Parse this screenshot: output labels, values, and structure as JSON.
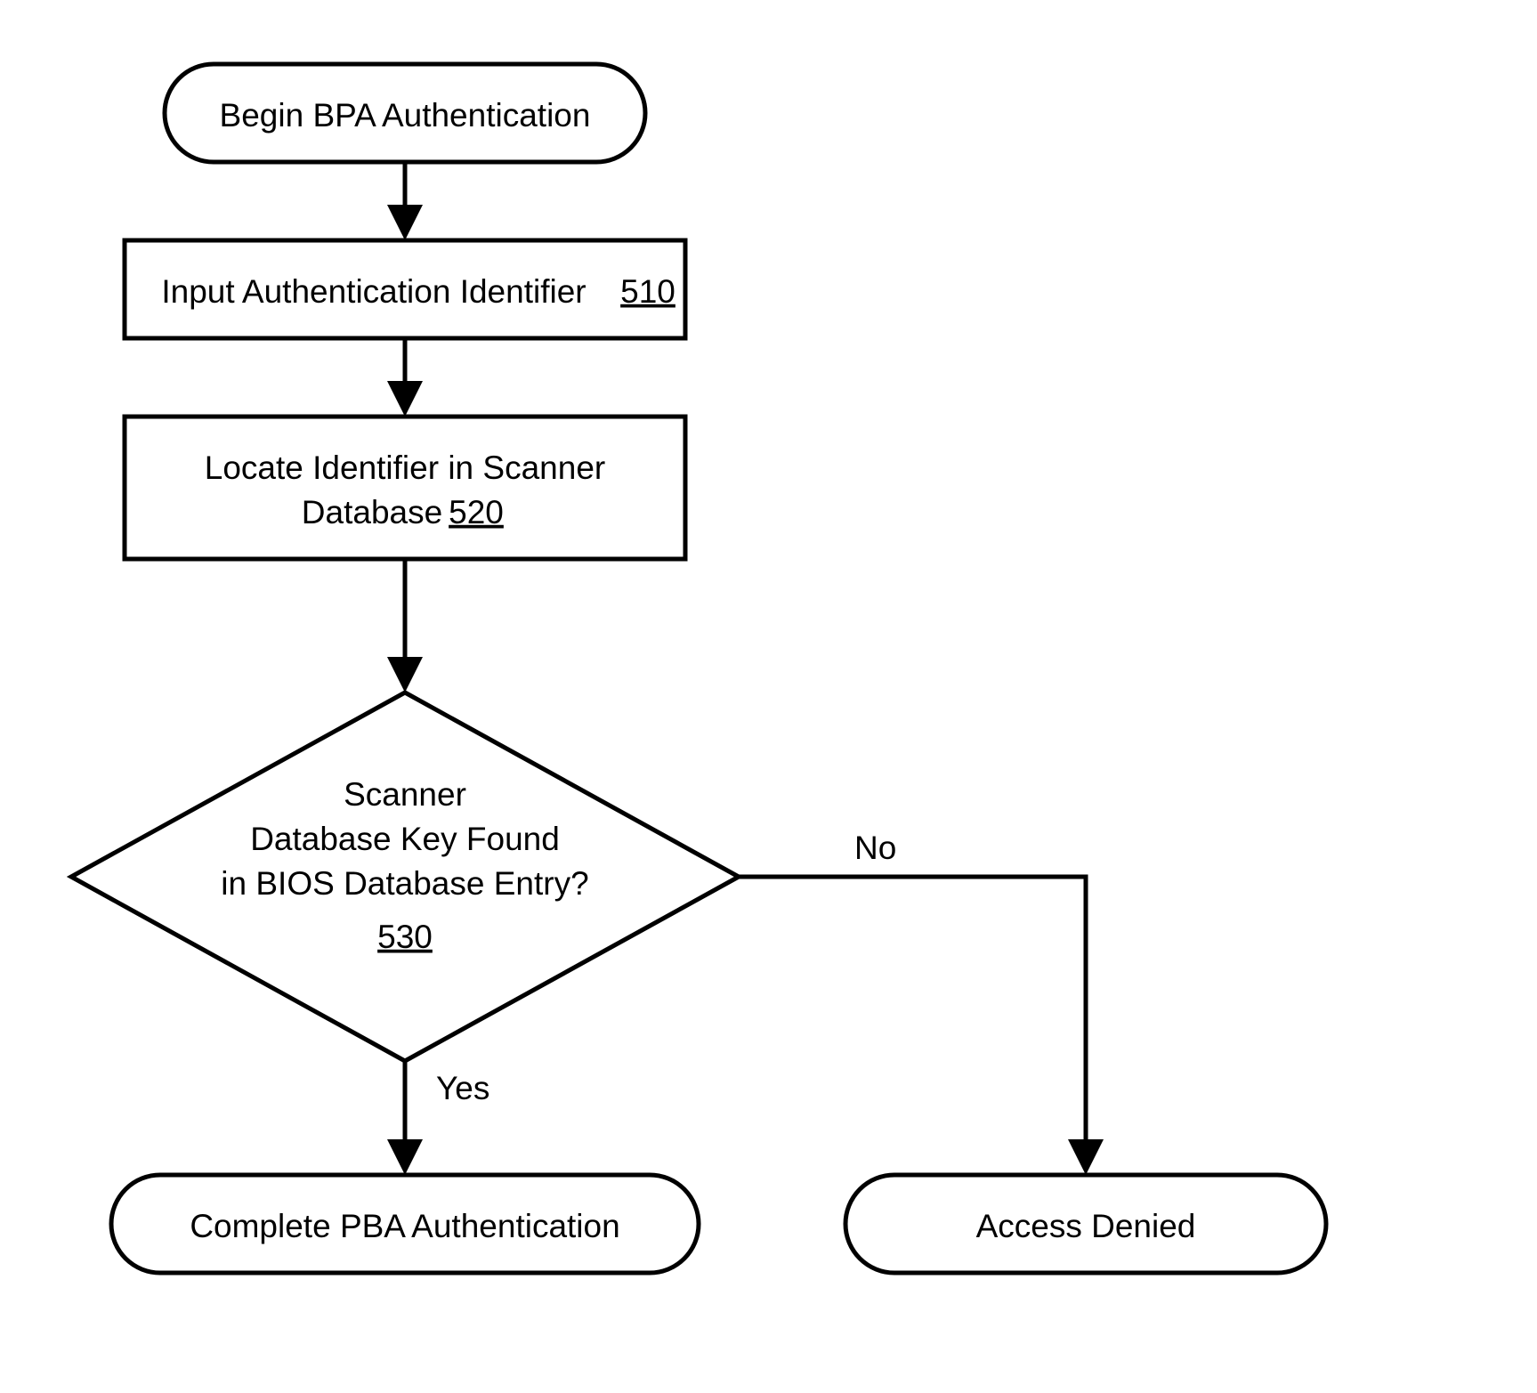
{
  "flowchart": {
    "start": {
      "label": "Begin BPA Authentication"
    },
    "step1": {
      "label": "Input Authentication Identifier",
      "ref": "510"
    },
    "step2": {
      "line1": "Locate Identifier in Scanner",
      "line2": "Database",
      "ref": "520"
    },
    "decision": {
      "line1": "Scanner",
      "line2": "Database Key Found",
      "line3": "in BIOS Database Entry?",
      "ref": "530",
      "yes_label": "Yes",
      "no_label": "No"
    },
    "end_yes": {
      "label": "Complete PBA Authentication"
    },
    "end_no": {
      "label": "Access Denied"
    }
  }
}
